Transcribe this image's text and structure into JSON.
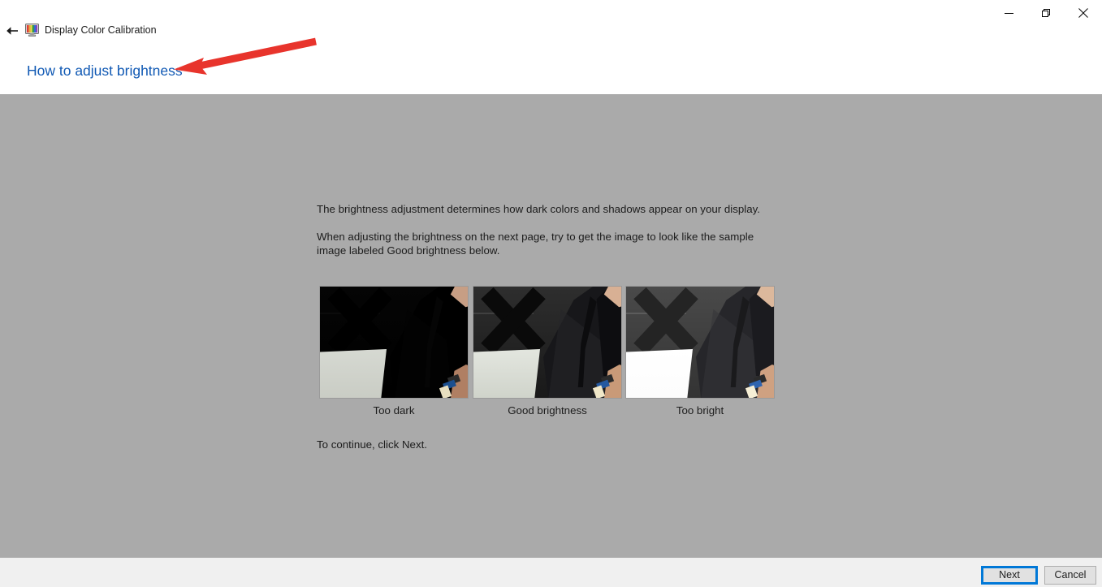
{
  "window": {
    "title": "Display Color Calibration",
    "icon": "monitor-color-icon",
    "back_label": "Back",
    "controls": {
      "minimize": "Minimize",
      "restore": "Restore",
      "close": "Close"
    }
  },
  "page": {
    "heading": "How to adjust brightness",
    "paragraph1": "The brightness adjustment determines how dark colors and shadows appear on your display.",
    "paragraph2": "When adjusting the brightness on the next page, try to get the image to look like the sample image labeled Good brightness below.",
    "paragraph3": "To continue, click Next."
  },
  "samples": [
    {
      "label": "Too dark",
      "wall_top": "#050505",
      "wall_bottom": "#000000",
      "x_color": "#000000",
      "line_color": "#0b0b0b",
      "sheet_top": "#d6d9d2",
      "sheet_bottom": "#c9ccc4",
      "suit": "#000000",
      "suit_sheen": "#030303",
      "lapel": "#050505",
      "shirt": "#000000",
      "skin": "#c79e84",
      "hand": "#b07f63",
      "held_blue": "#1c4f8f",
      "held_cream": "#e8dfc0"
    },
    {
      "label": "Good brightness",
      "wall_top": "#2e2e2e",
      "wall_bottom": "#191919",
      "x_color": "#0a0a0a",
      "line_color": "#404040",
      "sheet_top": "#e3e6df",
      "sheet_bottom": "#cfd3ca",
      "suit": "#17171a",
      "suit_sheen": "#26262a",
      "lapel": "#0c0c0e",
      "shirt": "#0d0d10",
      "skin": "#d8b094",
      "hand": "#c99a78",
      "held_blue": "#2458a0",
      "held_cream": "#f0e7c8"
    },
    {
      "label": "Too bright",
      "wall_top": "#4a4a4a",
      "wall_bottom": "#333333",
      "x_color": "#242424",
      "line_color": "#5c5c5c",
      "sheet_top": "#ffffff",
      "sheet_bottom": "#fcfcfc",
      "suit": "#26262a",
      "suit_sheen": "#343438",
      "lapel": "#1a1a1c",
      "shirt": "#1b1b1f",
      "skin": "#dcb89c",
      "hand": "#cfa181",
      "held_blue": "#2f64b0",
      "held_cream": "#f6efd6"
    }
  ],
  "footer": {
    "next_label": "Next",
    "cancel_label": "Cancel"
  },
  "annotation": {
    "arrow_color": "#e8342c",
    "arrow_name": "red-pointer-arrow"
  },
  "colors": {
    "content_background": "#aaaaaa",
    "footer_background": "#f0f0f0",
    "link": "#1059b4",
    "focus_border": "#0078d7"
  }
}
